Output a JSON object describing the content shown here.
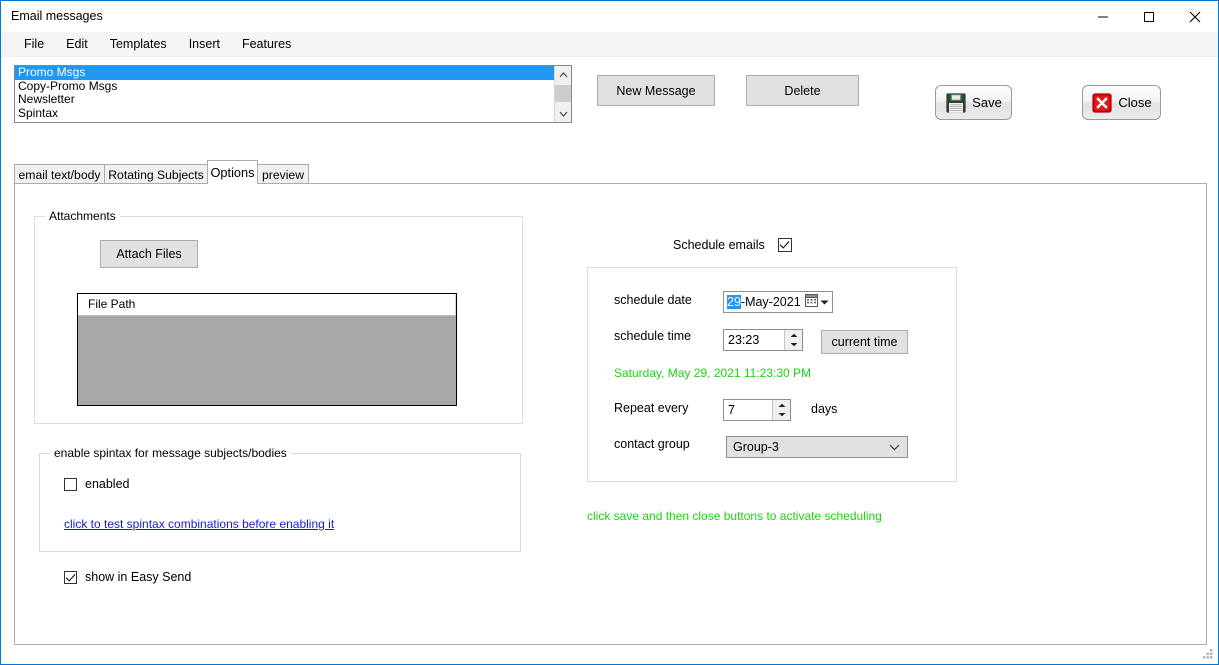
{
  "window": {
    "title": "Email messages",
    "controls": {
      "minimize": "minimize-icon",
      "maximize": "maximize-icon",
      "close": "close-icon"
    }
  },
  "menubar": {
    "items": [
      {
        "label": "File"
      },
      {
        "label": "Edit"
      },
      {
        "label": "Templates"
      },
      {
        "label": "Insert"
      },
      {
        "label": "Features"
      }
    ]
  },
  "message_list": {
    "items": [
      {
        "label": "Promo Msgs",
        "selected": true
      },
      {
        "label": "Copy-Promo Msgs",
        "selected": false
      },
      {
        "label": "Newsletter",
        "selected": false
      },
      {
        "label": "Spintax",
        "selected": false
      }
    ]
  },
  "toolbar": {
    "new_message_label": "New Message",
    "delete_label": "Delete",
    "save_label": "Save",
    "close_label": "Close",
    "save_icon": "floppy-disk-icon",
    "close_icon": "red-x-icon"
  },
  "tabs": [
    {
      "label": "email text/body",
      "active": false
    },
    {
      "label": "Rotating Subjects",
      "active": false
    },
    {
      "label": "Options",
      "active": true
    },
    {
      "label": "preview",
      "active": false
    }
  ],
  "attachments": {
    "group_title": "Attachments",
    "attach_button_label": "Attach Files",
    "grid": {
      "columns": [
        "File Path"
      ],
      "rows": []
    }
  },
  "spintax": {
    "group_title": "enable spintax for message subjects/bodies",
    "enabled_label": "enabled",
    "enabled_checked": false,
    "test_link_label": "click to test spintax combinations before enabling it"
  },
  "easy_send": {
    "label": "show in Easy Send",
    "checked": true
  },
  "schedule": {
    "toggle_label": "Schedule emails",
    "toggle_checked": true,
    "date_label": "schedule date",
    "date_selected_part": "29",
    "date_rest": "-May-2021",
    "date_picker_icon": "calendar-icon",
    "date_dropdown_icon": "chevron-down-icon",
    "time_label": "schedule time",
    "time_value": "23:23",
    "current_time_label": "current time",
    "timestamp": "Saturday, May 29, 2021 11:23:30 PM",
    "repeat_label": "Repeat every",
    "repeat_value": "7",
    "days_label": "days",
    "contact_group_label": "contact group",
    "contact_group_value": "Group-3",
    "hint": "click save and then close buttons to activate scheduling",
    "accent_green": "#1fd214",
    "accent_blue": "#2196f3"
  }
}
